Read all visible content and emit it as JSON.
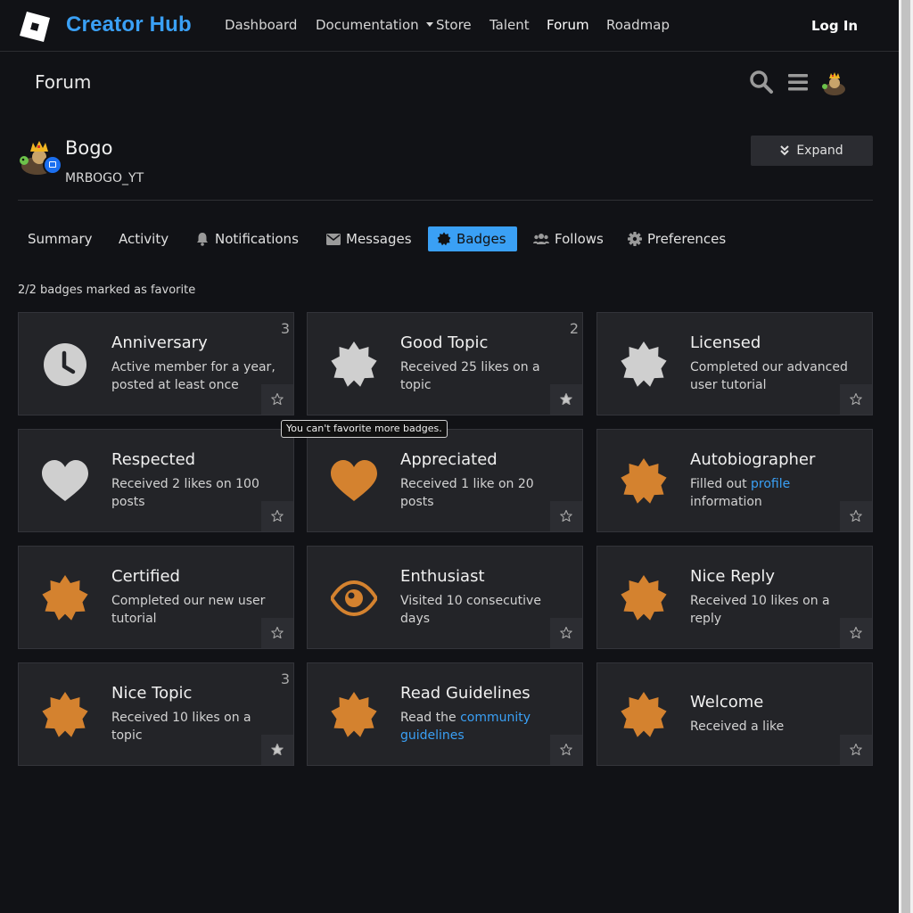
{
  "topnav": {
    "brand": "Creator Hub",
    "items": [
      "Dashboard",
      "Documentation",
      "Store",
      "Talent",
      "Forum",
      "Roadmap"
    ],
    "login": "Log In",
    "brand_color": "#3aa0f5"
  },
  "forum": {
    "title": "Forum",
    "icons": [
      "search-icon",
      "hamburger-icon",
      "avatar"
    ]
  },
  "profile": {
    "name": "Bogo",
    "username": "MRBOGO_YT",
    "expand_label": "Expand"
  },
  "tabs": [
    {
      "label": "Summary",
      "icon": ""
    },
    {
      "label": "Activity",
      "icon": ""
    },
    {
      "label": "Notifications",
      "icon": "bell-icon"
    },
    {
      "label": "Messages",
      "icon": "envelope-icon"
    },
    {
      "label": "Badges",
      "icon": "badge-icon",
      "active": true
    },
    {
      "label": "Follows",
      "icon": "users-icon"
    },
    {
      "label": "Preferences",
      "icon": "gear-icon"
    }
  ],
  "favorite_text": "2/2 badges marked as favorite",
  "tooltip": "You can't favorite more badges.",
  "badges": [
    {
      "title": "Anniversary",
      "desc": "Active member for a year, posted at least once",
      "count": "3",
      "icon": "clock-icon",
      "color": "#cfcfcf",
      "favorite": false
    },
    {
      "title": "Good Topic",
      "desc": "Received 25 likes on a topic",
      "count": "2",
      "icon": "certificate-icon",
      "color": "#cfcfcf",
      "favorite": true
    },
    {
      "title": "Licensed",
      "desc": "Completed our advanced user tutorial",
      "count": "",
      "icon": "certificate-icon",
      "color": "#cfcfcf",
      "favorite": false
    },
    {
      "title": "Respected",
      "desc": "Received 2 likes on 100 posts",
      "count": "",
      "icon": "heart-icon",
      "color": "#cfcfcf",
      "favorite": false
    },
    {
      "title": "Appreciated",
      "desc": "Received 1 like on 20 posts",
      "count": "",
      "icon": "heart-icon",
      "color": "#d4822f",
      "favorite": false
    },
    {
      "title": "Autobiographer",
      "desc_pre": "Filled out ",
      "desc_link": "profile",
      "desc_post": " information",
      "count": "",
      "icon": "certificate-icon",
      "color": "#d4822f",
      "favorite": false
    },
    {
      "title": "Certified",
      "desc": "Completed our new user tutorial",
      "count": "",
      "icon": "certificate-icon",
      "color": "#d4822f",
      "favorite": false
    },
    {
      "title": "Enthusiast",
      "desc": "Visited 10 consecutive days",
      "count": "",
      "icon": "eye-icon",
      "color": "#d4822f",
      "favorite": false
    },
    {
      "title": "Nice Reply",
      "desc": "Received 10 likes on a reply",
      "count": "",
      "icon": "certificate-icon",
      "color": "#d4822f",
      "favorite": false
    },
    {
      "title": "Nice Topic",
      "desc": "Received 10 likes on a topic",
      "count": "3",
      "icon": "certificate-icon",
      "color": "#d4822f",
      "favorite": true
    },
    {
      "title": "Read Guidelines",
      "desc_pre": "Read the ",
      "desc_link": "community guidelines",
      "desc_post": "",
      "count": "",
      "icon": "certificate-icon",
      "color": "#d4822f",
      "favorite": false
    },
    {
      "title": "Welcome",
      "desc": "Received a like",
      "count": "",
      "icon": "certificate-icon",
      "color": "#d4822f",
      "favorite": false
    }
  ]
}
